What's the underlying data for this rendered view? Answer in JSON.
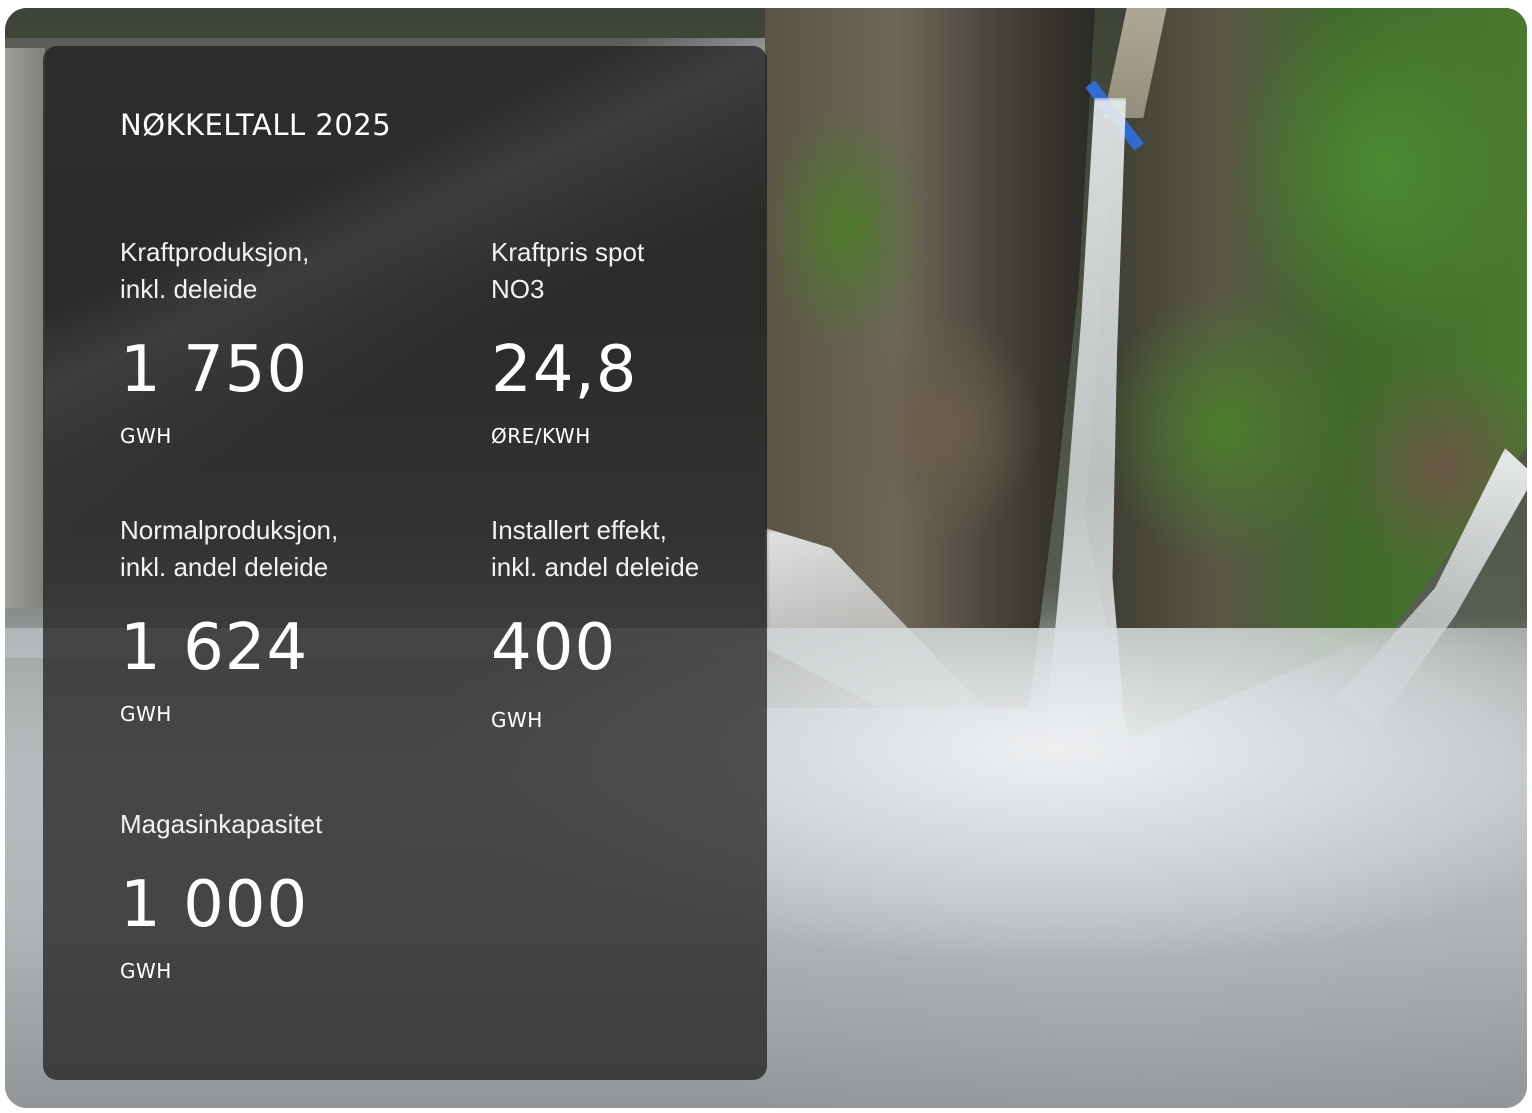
{
  "panel": {
    "title": "NØKKELTALL 2025",
    "stats": [
      {
        "label": "Kraftproduksjon,\ninkl. deleide",
        "value": "1 750",
        "unit": "GWH"
      },
      {
        "label": "Kraftpris spot\nNO3",
        "value": "24,8",
        "unit": "ØRE/KWH"
      },
      {
        "label": "Normalproduksjon,\ninkl. andel deleide",
        "value": "1 624",
        "unit": "GWH"
      },
      {
        "label": "Installert effekt,\ninkl. andel deleide",
        "value": "400",
        "unit": "GWH"
      },
      {
        "label": "Magasinkapasitet",
        "value": "1 000",
        "unit": "GWH"
      }
    ]
  },
  "colors": {
    "panel_bg": "#1e1e1e",
    "text": "#ffffff"
  }
}
